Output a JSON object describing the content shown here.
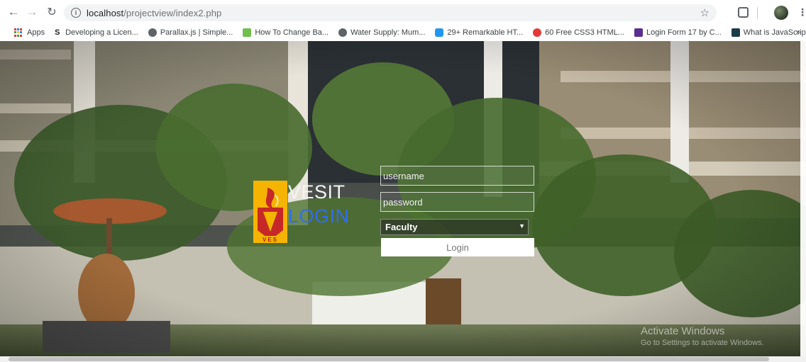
{
  "browser": {
    "url_host": "localhost",
    "url_path": "/projectview/index2.php"
  },
  "bookmarks": [
    {
      "label": "Apps",
      "icon": "apps-grid-icon"
    },
    {
      "label": "Developing a Licen...",
      "icon": "s-site-icon"
    },
    {
      "label": "Parallax.js | Simple...",
      "icon": "globe-icon"
    },
    {
      "label": "How To Change Ba...",
      "icon": "green-site-icon"
    },
    {
      "label": "Water Supply: Mum...",
      "icon": "globe-icon"
    },
    {
      "label": "29+ Remarkable HT...",
      "icon": "t-site-icon"
    },
    {
      "label": "60 Free CSS3 HTML...",
      "icon": "red-site-icon"
    },
    {
      "label": "Login Form 17 by C...",
      "icon": "purple-site-icon"
    },
    {
      "label": "What is JavaScript?...",
      "icon": "dark-site-icon"
    }
  ],
  "login": {
    "brand_line1": "VESIT",
    "brand_line2": "LOGIN",
    "logo_caption": "VES",
    "username_placeholder": "username",
    "password_placeholder": "password",
    "role_selected": "Faculty",
    "login_label": "Login"
  },
  "watermark": {
    "line1": "Activate Windows",
    "line2": "Go to Settings to activate Windows."
  },
  "colors": {
    "brand_accent": "#2f6df0",
    "logo_red": "#c62828",
    "logo_gold": "#f5b400"
  }
}
